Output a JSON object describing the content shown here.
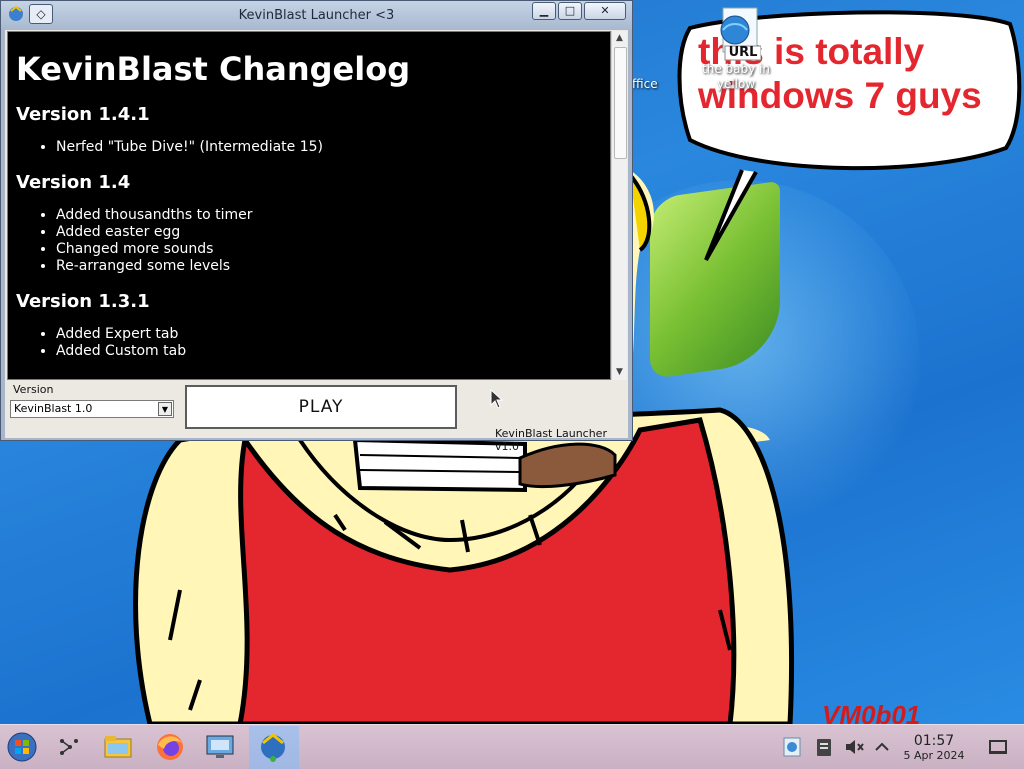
{
  "window": {
    "title": "KevinBlast Launcher <3",
    "menu_glyph": "◇",
    "controls": {
      "minimize": "▁",
      "maximize": "□",
      "close": "✕"
    }
  },
  "changelog": {
    "heading": "KevinBlast Changelog",
    "versions": [
      {
        "version": "Version 1.4.1",
        "items": [
          "Nerfed \"Tube Dive!\" (Intermediate 15)"
        ]
      },
      {
        "version": "Version 1.4",
        "items": [
          "Added thousandths to timer",
          "Added easter egg",
          "Changed more sounds",
          "Re-arranged some levels"
        ]
      },
      {
        "version": "Version 1.3.1",
        "items": [
          "Added Expert tab",
          "Added Custom tab"
        ]
      }
    ]
  },
  "launcher": {
    "version_label": "Version",
    "version_selected": "KevinBlast 1.0",
    "play_label": "PLAY",
    "footer": "KevinBlast Launcher v1.0"
  },
  "desktop": {
    "speech_text": "this is totally windows 7 guys",
    "url_icon_text": "URL",
    "url_icon_label": "the baby in yellow",
    "office_label": "ffice",
    "watermark": "VM0b01"
  },
  "taskbar": {
    "time": "01:57",
    "date": "5 Apr 2024"
  },
  "colors": {
    "speech_red": "#e4262e",
    "desktop_blue": "#2a87de",
    "taskbar": "#d2bccb"
  }
}
